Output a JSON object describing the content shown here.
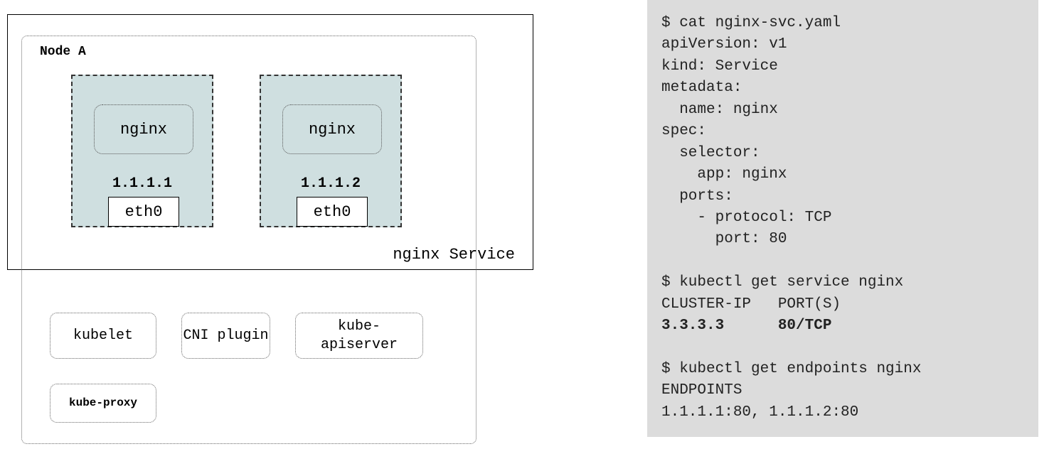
{
  "diagram": {
    "service_label": "nginx Service",
    "node_label": "Node A",
    "pods": [
      {
        "container": "nginx",
        "ip": "1.1.1.1",
        "iface": "eth0"
      },
      {
        "container": "nginx",
        "ip": "1.1.1.2",
        "iface": "eth0"
      }
    ],
    "components": {
      "kubelet": "kubelet",
      "cni": "CNI\nplugin",
      "apiserver": "kube-\napiserver",
      "kubeproxy": "kube-proxy"
    }
  },
  "terminal": {
    "cmd1": "$ cat nginx-svc.yaml",
    "yaml_l1": "apiVersion: v1",
    "yaml_l2": "kind: Service",
    "yaml_l3": "metadata:",
    "yaml_l4": "  name: nginx",
    "yaml_l5": "spec:",
    "yaml_l6": "  selector:",
    "yaml_l7": "    app: nginx",
    "yaml_l8": "  ports:",
    "yaml_l9": "    - protocol: TCP",
    "yaml_l10": "      port: 80",
    "cmd2": "$ kubectl get service nginx",
    "svc_header": "CLUSTER-IP   PORT(S)",
    "svc_row": "3.3.3.3      80/TCP",
    "cmd3": "$ kubectl get endpoints nginx",
    "ep_header": "ENDPOINTS",
    "ep_row": "1.1.1.1:80, 1.1.1.2:80"
  }
}
